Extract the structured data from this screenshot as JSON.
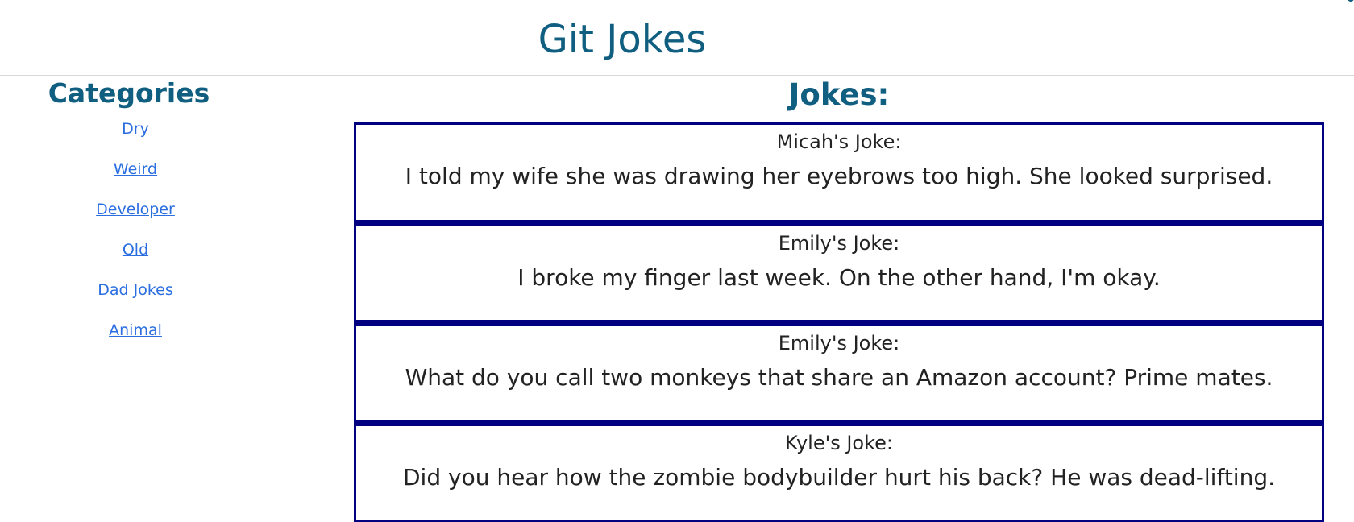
{
  "header": {
    "title": "Git Jokes"
  },
  "sidebar": {
    "heading": "Categories",
    "categories": [
      "Dry",
      "Weird",
      "Developer",
      "Old",
      "Dad Jokes",
      "Animal"
    ]
  },
  "main": {
    "heading": "Jokes:",
    "jokes": [
      {
        "author": "Micah's Joke:",
        "text": "I told my wife she was drawing her eyebrows too high. She looked surprised."
      },
      {
        "author": "Emily's Joke:",
        "text": "I broke my finger last week. On the other hand, I'm okay."
      },
      {
        "author": "Emily's Joke:",
        "text": "What do you call two monkeys that share an Amazon account? Prime mates."
      },
      {
        "author": "Kyle's Joke:",
        "text": "Did you hear how the zombie bodybuilder hurt his back? He was dead-lifting."
      }
    ]
  },
  "colors": {
    "brand": "#105e80",
    "link": "#2a6ee0",
    "card_border": "#000080",
    "text": "#222222"
  }
}
